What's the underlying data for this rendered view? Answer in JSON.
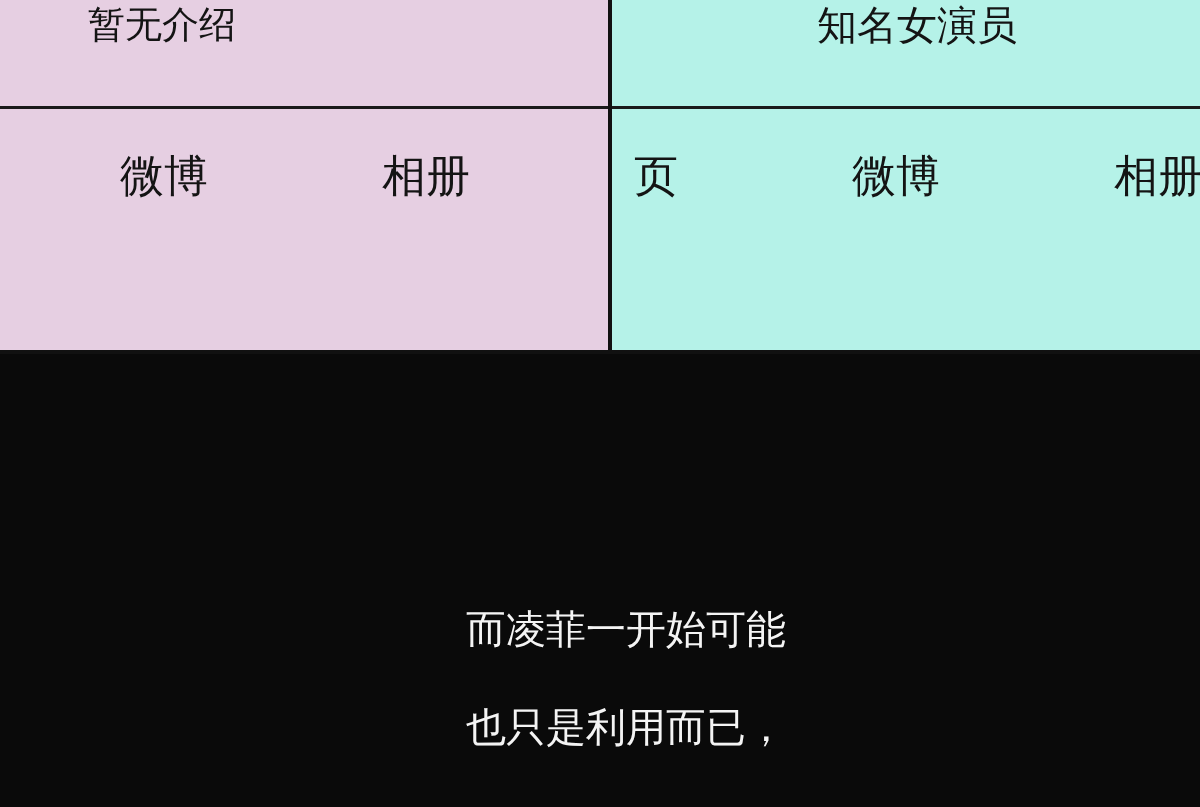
{
  "profile_cards": [
    {
      "color": "#e6cfe2",
      "description": "暂无介绍",
      "links": [
        "微博",
        "相册"
      ]
    },
    {
      "color": "#b5f2e8",
      "description": "知名女演员",
      "links": [
        "页",
        "微博",
        "相册"
      ]
    }
  ],
  "caption_lines": [
    "而凌菲一开始可能",
    "也只是利用而已，"
  ]
}
